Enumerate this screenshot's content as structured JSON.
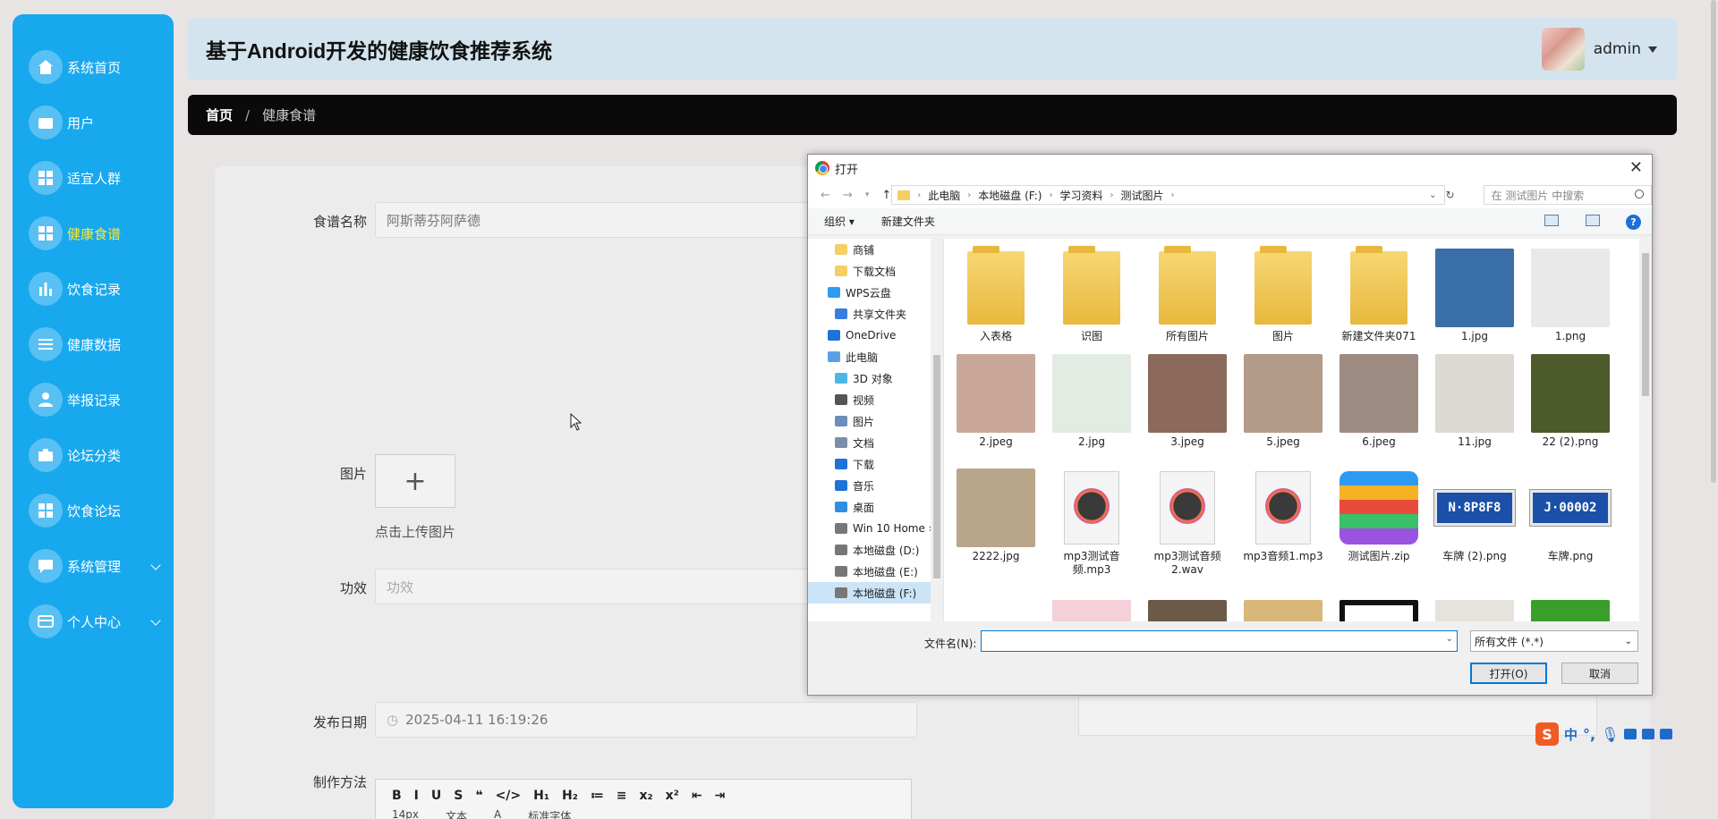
{
  "app": {
    "title": "基于Android开发的健康饮食推荐系统",
    "username": "admin"
  },
  "sidebar": {
    "items": [
      {
        "label": "系统首页",
        "icon": "home-icon"
      },
      {
        "label": "用户",
        "icon": "wallet-icon"
      },
      {
        "label": "适宜人群",
        "icon": "grid-icon"
      },
      {
        "label": "健康食谱",
        "icon": "grid-icon",
        "active": true
      },
      {
        "label": "饮食记录",
        "icon": "bar-chart-icon"
      },
      {
        "label": "健康数据",
        "icon": "sliders-icon"
      },
      {
        "label": "举报记录",
        "icon": "person-icon"
      },
      {
        "label": "论坛分类",
        "icon": "briefcase-icon"
      },
      {
        "label": "饮食论坛",
        "icon": "grid-icon"
      },
      {
        "label": "系统管理",
        "icon": "chat-icon",
        "expandable": true
      },
      {
        "label": "个人中心",
        "icon": "card-icon",
        "expandable": true
      }
    ]
  },
  "breadcrumb": {
    "home": "首页",
    "separator": "/",
    "current": "健康食谱"
  },
  "form": {
    "name_label": "食谱名称",
    "name_value": "阿斯蒂芬阿萨德",
    "image_label": "图片",
    "upload_plus": "+",
    "upload_hint": "点击上传图片",
    "effect_label": "功效",
    "effect_placeholder": "功效",
    "date_label": "发布日期",
    "date_value": "2025-04-11 16:19:26",
    "method_label": "制作方法",
    "toolbar": [
      "B",
      "I",
      "U",
      "S",
      "❝",
      "</>",
      "H₁",
      "H₂",
      "≔",
      "≡",
      "x₂",
      "x²",
      "⇤",
      "⇥"
    ],
    "toolbar_row2": [
      "14px",
      "文本",
      "A",
      "标准字体"
    ]
  },
  "dialog": {
    "title": "打开",
    "address": [
      "此电脑",
      "本地磁盘 (F:)",
      "学习资料",
      "测试图片"
    ],
    "search_placeholder": "在 测试图片 中搜索",
    "organize": "组织 ▾",
    "new_folder": "新建文件夹",
    "tree": [
      {
        "label": "商铺",
        "color": "#f3cf64",
        "indent": 1
      },
      {
        "label": "下载文档",
        "color": "#f3cf64",
        "indent": 1
      },
      {
        "label": "WPS云盘",
        "color": "#2f9bf0",
        "indent": 0
      },
      {
        "label": "共享文件夹",
        "color": "#3b7ddd",
        "indent": 1
      },
      {
        "label": "OneDrive",
        "color": "#1e73d8",
        "indent": 0
      },
      {
        "label": "此电脑",
        "color": "#5aa0e6",
        "indent": 0
      },
      {
        "label": "3D 对象",
        "color": "#4bb7e8",
        "indent": 1
      },
      {
        "label": "视频",
        "color": "#555555",
        "indent": 1
      },
      {
        "label": "图片",
        "color": "#6a8fb8",
        "indent": 1
      },
      {
        "label": "文档",
        "color": "#7a8ea8",
        "indent": 1
      },
      {
        "label": "下载",
        "color": "#1e73d8",
        "indent": 1
      },
      {
        "label": "音乐",
        "color": "#1e73d8",
        "indent": 1
      },
      {
        "label": "桌面",
        "color": "#2f8fe0",
        "indent": 1
      },
      {
        "label": "Win 10 Home ›",
        "color": "#777777",
        "indent": 1
      },
      {
        "label": "本地磁盘 (D:)",
        "color": "#777777",
        "indent": 1
      },
      {
        "label": "本地磁盘 (E:)",
        "color": "#777777",
        "indent": 1
      },
      {
        "label": "本地磁盘 (F:)",
        "color": "#777777",
        "indent": 1,
        "selected": true
      }
    ],
    "files": [
      {
        "name": "入表格",
        "kind": "folder"
      },
      {
        "name": "识图",
        "kind": "folder"
      },
      {
        "name": "所有图片",
        "kind": "folder"
      },
      {
        "name": "图片",
        "kind": "folder"
      },
      {
        "name": "新建文件夹071",
        "kind": "folder"
      },
      {
        "name": "1.jpg",
        "kind": "image",
        "color": "#3a6ea8"
      },
      {
        "name": "1.png",
        "kind": "image",
        "color": "#e9e9e9"
      },
      {
        "name": "2.jpeg",
        "kind": "image",
        "color": "#c9a89a"
      },
      {
        "name": "2.jpg",
        "kind": "image",
        "color": "#e3ece2"
      },
      {
        "name": "3.jpeg",
        "kind": "image",
        "color": "#8b6a5c"
      },
      {
        "name": "5.jpeg",
        "kind": "image",
        "color": "#b49a88"
      },
      {
        "name": "6.jpeg",
        "kind": "image",
        "color": "#9e8b82"
      },
      {
        "name": "11.jpg",
        "kind": "image",
        "color": "#dcd8d2"
      },
      {
        "name": "22 (2).png",
        "kind": "image",
        "color": "#4d5a2a"
      },
      {
        "name": "2222.jpg",
        "kind": "image",
        "color": "#b8a58a"
      },
      {
        "name": "mp3测试音频.mp3",
        "kind": "audio"
      },
      {
        "name": "mp3测试音频2.wav",
        "kind": "audio"
      },
      {
        "name": "mp3音频1.mp3",
        "kind": "audio"
      },
      {
        "name": "测试图片.zip",
        "kind": "zip"
      },
      {
        "name": "车牌 (2).png",
        "kind": "plate",
        "plate": "N·8P8F8"
      },
      {
        "name": "车牌.png",
        "kind": "plate",
        "plate": "J·00002"
      }
    ],
    "filename_label": "文件名(N):",
    "filetype": "所有文件 (*.*)",
    "open_button": "打开(O)",
    "cancel_button": "取消"
  },
  "ime": {
    "logo": "S",
    "mode": "中"
  }
}
